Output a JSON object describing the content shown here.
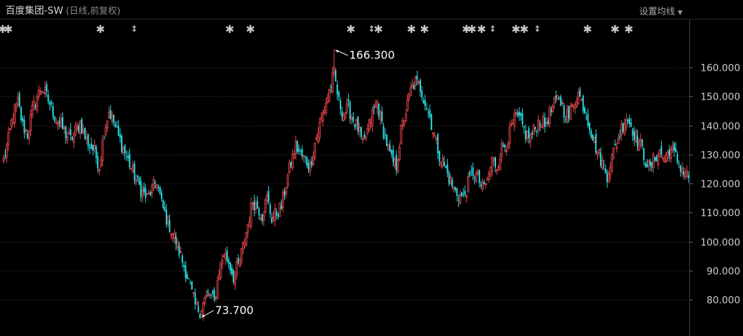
{
  "header": {
    "stock_name": "百度集团-SW",
    "period_info": "(日线,前复权)",
    "ma_settings_label": "设置均线"
  },
  "colors": {
    "up": "#e8454b",
    "down": "#26e0e8",
    "grid": "#3a3a3a",
    "axis_text": "#cfcfcf",
    "marker": "#c8c8c8"
  },
  "chart_data": {
    "type": "candlestick",
    "title": "百度集团-SW",
    "ylim": [
      72,
      170
    ],
    "y_ticks": [
      160,
      150,
      140,
      130,
      120,
      110,
      100,
      90,
      80
    ],
    "y_tick_labels": [
      "160.000",
      "150.000",
      "140.000",
      "130.000",
      "120.000",
      "110.000",
      "100.000",
      "90.000",
      "80.000"
    ],
    "grid": true,
    "annotations": [
      {
        "label": "166.300",
        "value": 166.3,
        "kind": "high"
      },
      {
        "label": "73.700",
        "value": 73.7,
        "kind": "low"
      }
    ],
    "event_markers": [
      "*",
      "*",
      "*",
      "↕",
      "*",
      "*",
      "*",
      "↕*",
      "*",
      "*",
      "**",
      "*",
      "*",
      "**",
      "↕",
      "*",
      "*",
      "*"
    ],
    "key_closes": [
      128,
      135,
      144,
      148,
      140,
      137,
      145,
      150,
      153,
      150,
      146,
      142,
      140,
      137,
      135,
      138,
      141,
      136,
      133,
      131,
      126,
      138,
      145,
      141,
      136,
      132,
      128,
      124,
      120,
      117,
      115,
      118,
      121,
      113,
      108,
      104,
      100,
      95,
      90,
      84,
      78,
      76,
      80,
      82,
      79,
      90,
      96,
      93,
      88,
      92,
      98,
      106,
      114,
      112,
      109,
      115,
      108,
      110,
      112,
      120,
      127,
      133,
      130,
      128,
      126,
      134,
      140,
      146,
      152,
      158,
      148,
      144,
      146,
      142,
      139,
      133,
      138,
      144,
      148,
      140,
      134,
      128,
      126,
      138,
      145,
      152,
      155,
      153,
      148,
      143,
      136,
      130,
      126,
      122,
      118,
      116,
      115,
      120,
      124,
      122,
      118,
      121,
      128,
      126,
      132,
      134,
      139,
      143,
      141,
      137,
      136,
      139,
      142,
      140,
      144,
      147,
      150,
      145,
      143,
      148,
      151,
      147,
      142,
      136,
      131,
      127,
      123,
      129,
      134,
      139,
      143,
      140,
      136,
      133,
      128,
      125,
      129,
      131,
      128,
      132,
      130,
      127,
      124,
      122
    ]
  }
}
